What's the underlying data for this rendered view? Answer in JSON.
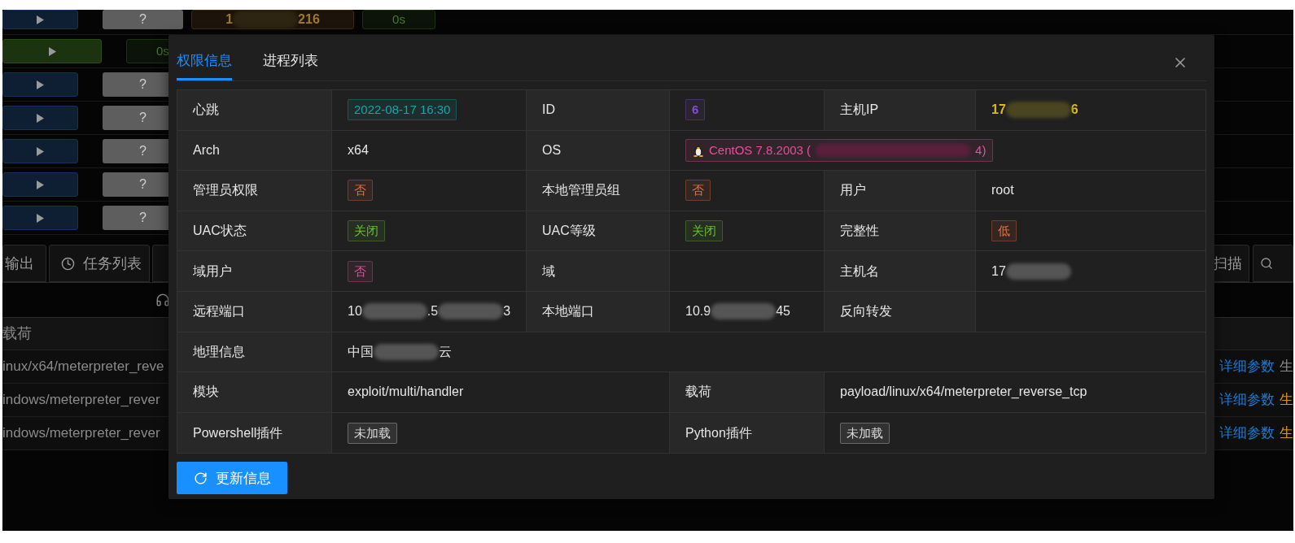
{
  "background": {
    "session_rows": [
      {
        "kind": "blue",
        "status": "?",
        "address": [
          "1",
          "216"
        ],
        "timer": "0s"
      },
      {
        "kind": "green",
        "timer": "0s"
      },
      {
        "kind": "blue",
        "status": "?"
      },
      {
        "kind": "blue",
        "status": "?"
      },
      {
        "kind": "blue",
        "status": "?"
      },
      {
        "kind": "blue",
        "status": "?"
      },
      {
        "kind": "blue",
        "status": "?"
      }
    ],
    "left_tabs": [
      {
        "kind": "plain",
        "label": "输出"
      },
      {
        "kind": "clock",
        "label": "任务列表"
      },
      {
        "kind": "blank"
      }
    ],
    "right_tabs": [
      {
        "kind": "plain",
        "label": "扫描"
      },
      {
        "kind": "search"
      }
    ],
    "payload_header": "载荷",
    "payload_rows": [
      {
        "payload": "inux/x64/meterpreter_reve",
        "link": "详细参数",
        "action": "生",
        "color": "#8c8c8c"
      },
      {
        "payload": "indows/meterpreter_rever",
        "link": "详细参数",
        "action": "生",
        "color": "#d89614"
      },
      {
        "payload": "indows/meterpreter_rever",
        "link": "详细参数",
        "action": "生",
        "color": "#d89614"
      }
    ]
  },
  "dialog": {
    "tabs": [
      {
        "label": "权限信息",
        "selected": true
      },
      {
        "label": "进程列表",
        "selected": false
      }
    ],
    "rows": [
      {
        "kind": "triple",
        "cells": [
          {
            "label": "心跳",
            "value": {
              "kind": "tag",
              "text": "2022-08-17 16:30",
              "color": "#13a8a8",
              "bold": false
            }
          },
          {
            "label": "ID",
            "value": {
              "kind": "tag",
              "text": "6",
              "color": "#854eca",
              "bold": true
            }
          },
          {
            "label": "主机IP",
            "value": {
              "kind": "redacted",
              "parts": [
                "17",
                "6"
              ],
              "highlight": true
            }
          }
        ]
      },
      {
        "kind": "pair_wide",
        "cells": [
          {
            "label": "Arch",
            "value": {
              "kind": "text",
              "text": "x64"
            }
          },
          {
            "label": "OS",
            "value": {
              "kind": "os_tag",
              "parts": [
                "CentOS 7.8.2003 (",
                "4)"
              ],
              "color": "#e0529c"
            }
          }
        ]
      },
      {
        "kind": "triple",
        "cells": [
          {
            "label": "管理员权限",
            "value": {
              "kind": "tag",
              "text": "否",
              "color": "#e87040",
              "bold": false
            }
          },
          {
            "label": "本地管理员组",
            "value": {
              "kind": "tag",
              "text": "否",
              "color": "#e87040",
              "bold": false
            }
          },
          {
            "label": "用户",
            "value": {
              "kind": "text",
              "text": "root"
            }
          }
        ]
      },
      {
        "kind": "triple",
        "cells": [
          {
            "label": "UAC状态",
            "value": {
              "kind": "tag",
              "text": "关闭",
              "color": "#6abe39",
              "bold": false
            }
          },
          {
            "label": "UAC等级",
            "value": {
              "kind": "tag",
              "text": "关闭",
              "color": "#6abe39",
              "bold": false
            }
          },
          {
            "label": "完整性",
            "value": {
              "kind": "tag",
              "text": "低",
              "color": "#e87040",
              "bold": false
            }
          }
        ]
      },
      {
        "kind": "triple",
        "cells": [
          {
            "label": "域用户",
            "value": {
              "kind": "tag",
              "text": "否",
              "color": "#e0529c",
              "bold": false
            }
          },
          {
            "label": "域"
          },
          {
            "label": "主机名",
            "value": {
              "kind": "redacted",
              "parts": [
                "17"
              ],
              "highlight": false
            }
          }
        ]
      },
      {
        "kind": "triple",
        "cells": [
          {
            "label": "远程端口",
            "value": {
              "kind": "redacted",
              "parts": [
                "10",
                ".5",
                "3"
              ],
              "highlight": false
            }
          },
          {
            "label": "本地端口",
            "value": {
              "kind": "redacted",
              "parts": [
                "10.9",
                "45"
              ],
              "highlight": false
            }
          },
          {
            "label": "反向转发"
          }
        ]
      },
      {
        "kind": "single",
        "cells": [
          {
            "label": "地理信息",
            "value": {
              "kind": "redacted",
              "parts": [
                "中国",
                "云"
              ],
              "highlight": false
            }
          }
        ]
      },
      {
        "kind": "pair_even",
        "cells": [
          {
            "label": "模块",
            "value": {
              "kind": "text",
              "text": "exploit/multi/handler"
            }
          },
          {
            "label": "载荷",
            "value": {
              "kind": "text",
              "text": "payload/linux/x64/meterpreter_reverse_tcp"
            }
          }
        ]
      },
      {
        "kind": "pair_even",
        "cells": [
          {
            "label": "Powershell插件",
            "value": {
              "kind": "tag",
              "text": "未加载",
              "color": "#d9d9d9",
              "bold": false
            }
          },
          {
            "label": "Python插件",
            "value": {
              "kind": "tag",
              "text": "未加载",
              "color": "#d9d9d9",
              "bold": false
            }
          }
        ]
      }
    ],
    "refresh_button": "更新信息"
  }
}
